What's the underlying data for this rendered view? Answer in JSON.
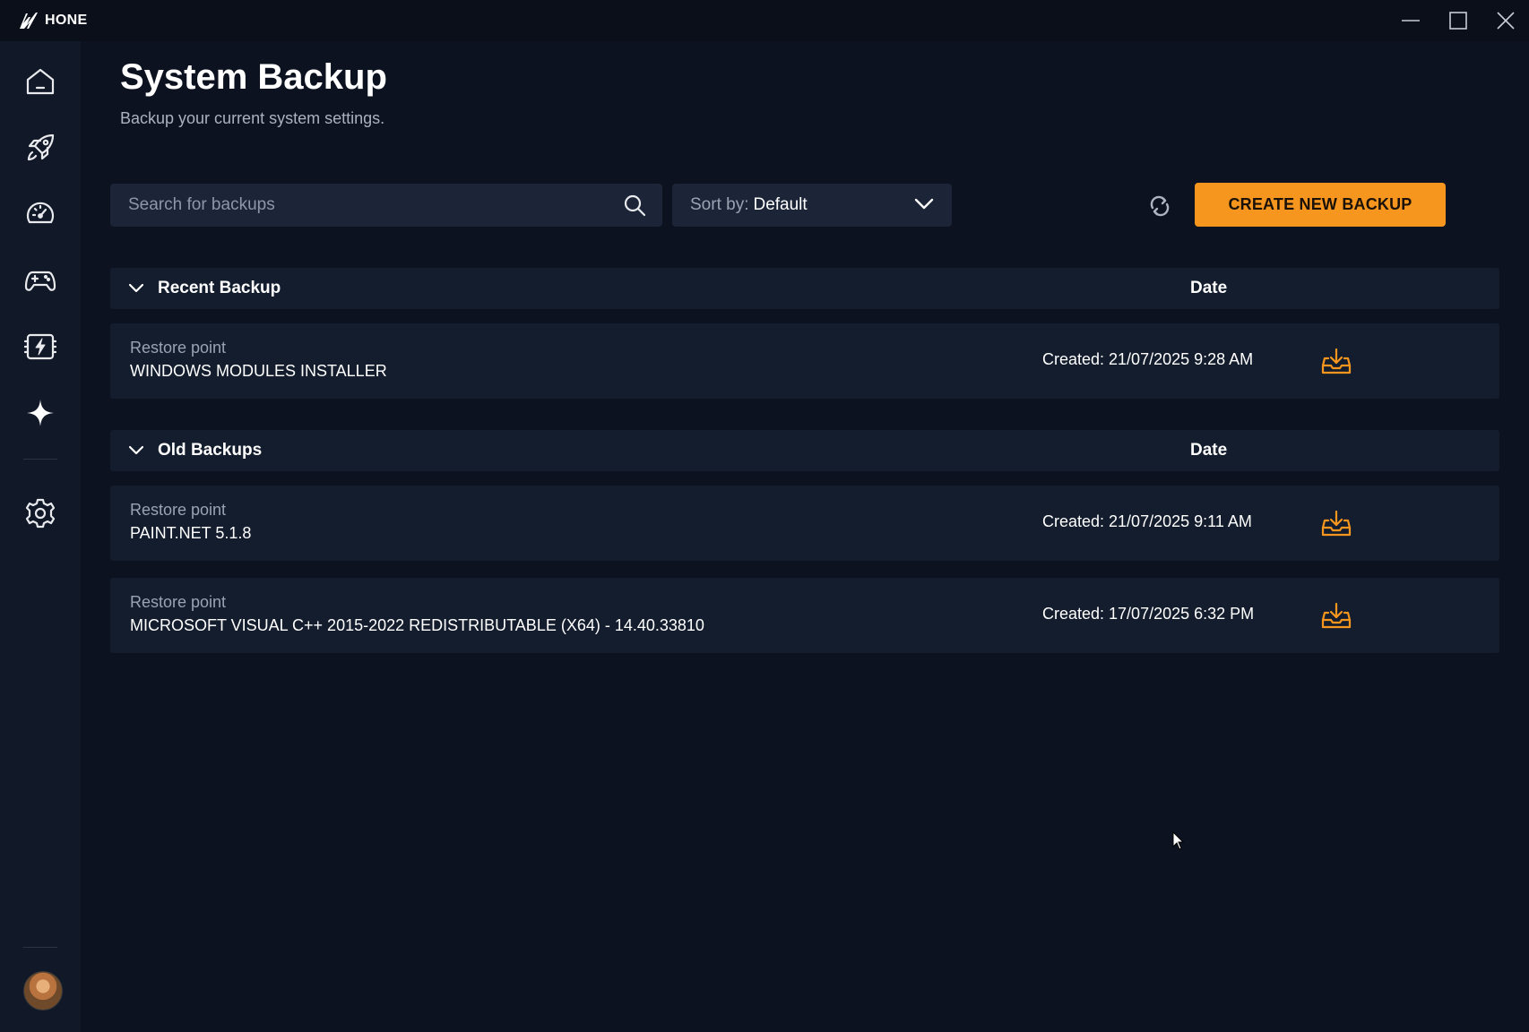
{
  "app": {
    "name": "HONE"
  },
  "window_controls": [
    "minimize-icon",
    "maximize-icon",
    "close-icon"
  ],
  "sidebar": {
    "items": [
      {
        "name": "home",
        "icon": "home-icon"
      },
      {
        "name": "boost",
        "icon": "rocket-icon"
      },
      {
        "name": "performance",
        "icon": "speedometer-icon"
      },
      {
        "name": "games",
        "icon": "gamepad-icon"
      },
      {
        "name": "power",
        "icon": "lightning-chip-icon"
      },
      {
        "name": "ai",
        "icon": "sparkle-icon"
      },
      {
        "name": "settings",
        "icon": "gear-icon"
      }
    ]
  },
  "header": {
    "title": "System Backup",
    "subtitle": "Backup your current system settings."
  },
  "toolbar": {
    "search_placeholder": "Search for backups",
    "sort_label": "Sort by:",
    "sort_value": "Default",
    "create_label": "CREATE NEW BACKUP"
  },
  "sections": {
    "recent": {
      "title": "Recent Backup",
      "date_header": "Date",
      "rows": [
        {
          "kind": "Restore point",
          "name": "WINDOWS MODULES INSTALLER",
          "date": "Created: 21/07/2025 9:28 AM"
        }
      ]
    },
    "old": {
      "title": "Old Backups",
      "date_header": "Date",
      "rows": [
        {
          "kind": "Restore point",
          "name": "PAINT.NET 5.1.8",
          "date": "Created: 21/07/2025 9:11 AM"
        },
        {
          "kind": "Restore point",
          "name": "MICROSOFT VISUAL C++ 2015-2022 REDISTRIBUTABLE (X64) - 14.40.33810",
          "date": "Created: 17/07/2025 6:32 PM"
        }
      ]
    }
  },
  "colors": {
    "accent": "#f7961e",
    "background": "#0c1220",
    "panel": "#141d2d",
    "sidebar": "#111827"
  }
}
